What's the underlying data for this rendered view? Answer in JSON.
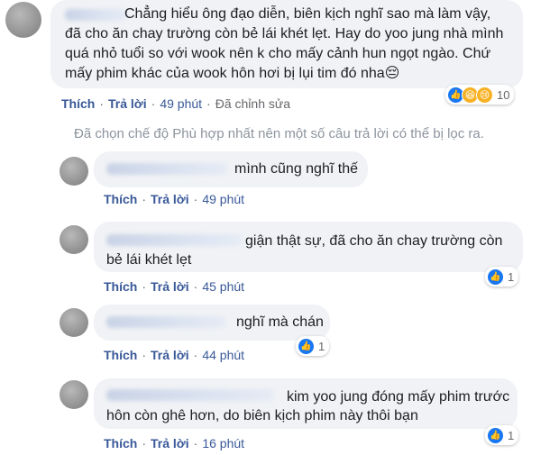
{
  "main_comment": {
    "lines": [
      "Chẳng hiểu ông đạo diễn, biên kịch nghĩ sao mà làm vậy,",
      "đã cho ăn chay trường còn bẻ lái khét lẹt. Hay do yoo jung nhà mình",
      "quá nhỏ tuổi so với wook nên k cho mấy cảnh hun ngọt ngào. Chứ",
      "mấy phim khác của wook hôn hơi bị lụi tim đó nha😔"
    ],
    "like_label": "Thích",
    "reply_label": "Trả lời",
    "time": "49 phút",
    "edited": "Đã chỉnh sửa",
    "reaction_count": "10"
  },
  "filter_notice": "Đã chọn chế độ Phù hợp nhất nên một số câu trả lời có thể bị lọc ra.",
  "replies": [
    {
      "lines": [
        "mình cũng nghĩ thế"
      ],
      "like_label": "Thích",
      "reply_label": "Trả lời",
      "time": "49 phút",
      "reaction_count": ""
    },
    {
      "lines": [
        "giận thật sự, đã cho ăn chay trường còn",
        "bẻ lái khét lẹt"
      ],
      "like_label": "Thích",
      "reply_label": "Trả lời",
      "time": "45 phút",
      "reaction_count": "1"
    },
    {
      "lines": [
        "nghĩ mà chán"
      ],
      "like_label": "Thích",
      "reply_label": "Trả lời",
      "time": "44 phút",
      "reaction_count": "1"
    },
    {
      "lines": [
        "kim yoo jung đóng mấy phim trước",
        "hôn còn ghê hơn, do biên kịch phim này thôi bạn"
      ],
      "like_label": "Thích",
      "reply_label": "Trả lời",
      "time": "16 phút",
      "reaction_count": "1"
    }
  ],
  "colors": {
    "bubble": "#f0f2f5",
    "link": "#385898",
    "meta": "#65676b",
    "like": "#1877f2"
  }
}
